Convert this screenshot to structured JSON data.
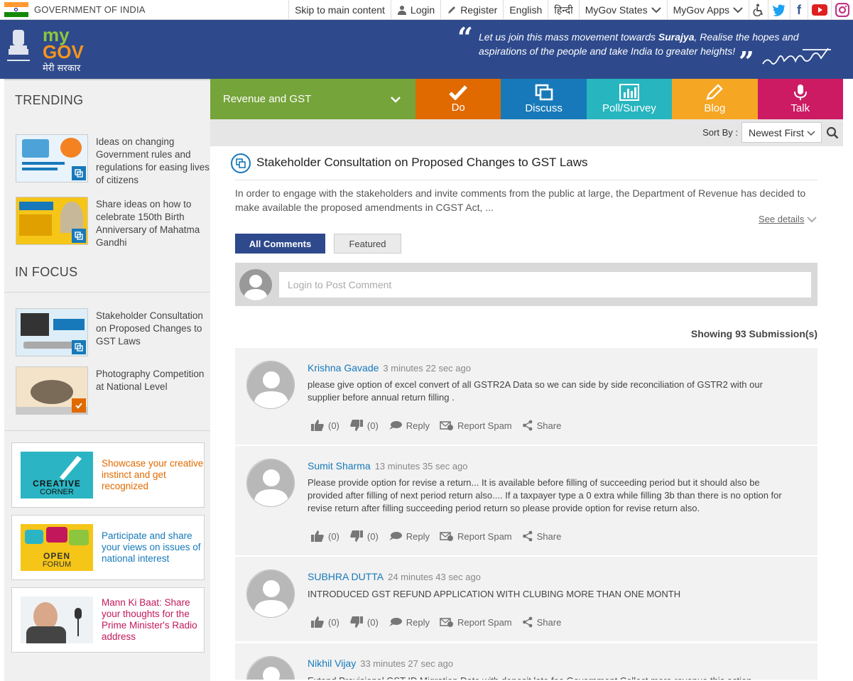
{
  "govbar": {
    "title": "GOVERNMENT OF INDIA",
    "links": [
      "Skip to main content",
      "Login",
      "Register",
      "English",
      "हिन्दी",
      "MyGov States",
      "MyGov Apps"
    ]
  },
  "header": {
    "logo_top": "my",
    "logo_mid": "GOV",
    "logo_sub": "मेरी सरकार",
    "quote_a": "Let us join this mass movement towards ",
    "quote_b": "Surajya",
    "quote_c": ", Realise the hopes and aspirations of the people and take India to greater heights!"
  },
  "sidebar": {
    "trending_title": "TRENDING",
    "trending": [
      {
        "text": "Ideas on changing Government rules and regulations for easing lives of citizens"
      },
      {
        "text": "Share ideas on how to celebrate 150th Birth Anniversary of Mahatma Gandhi"
      }
    ],
    "focus_title": "IN FOCUS",
    "focus": [
      {
        "text": "Stakeholder Consultation on Proposed Changes to GST Laws"
      },
      {
        "text": "Photography Competition at National Level"
      }
    ],
    "promos": [
      {
        "text": "Showcase your creative instinct and get recognized",
        "img_label_a": "CREATIVE",
        "img_label_b": "CORNER",
        "color": "#e06a00"
      },
      {
        "text": "Participate and share your views on issues of national interest",
        "img_label_a": "OPEN",
        "img_label_b": "FORUM",
        "color": "#1779ba"
      },
      {
        "text": "Mann Ki Baat: Share your thoughts for the Prime Minister's Radio address",
        "color": "#c2185b"
      }
    ]
  },
  "tabs": {
    "dropdown": "Revenue and GST",
    "items": [
      {
        "label": "Do",
        "color": "#e06a00"
      },
      {
        "label": "Discuss",
        "color": "#1779ba"
      },
      {
        "label": "Poll/Survey",
        "color": "#27b5bf"
      },
      {
        "label": "Blog",
        "color": "#f5a623"
      },
      {
        "label": "Talk",
        "color": "#cc1a63"
      }
    ]
  },
  "sort": {
    "label": "Sort By :",
    "value": "Newest First"
  },
  "discussion": {
    "title": "Stakeholder Consultation on Proposed Changes to GST Laws",
    "description": "In order to engage with the stakeholders and invite comments from the public at large, the Department of Revenue has decided to make available the proposed amendments in CGST Act, ...",
    "see_details": "See details",
    "tab_all": "All Comments",
    "tab_featured": "Featured",
    "post_placeholder": "Login to Post Comment",
    "showing": "Showing 93 Submission(s)"
  },
  "comments": [
    {
      "name": "Krishna Gavade",
      "time": "3 minutes 22 sec ago",
      "text": "please give option of excel convert of all GSTR2A Data so we can side by side reconciliation of GSTR2 with our supplier before annual return filling .",
      "likes": "(0)",
      "dislikes": "(0)"
    },
    {
      "name": "Sumit Sharma",
      "time": "13 minutes 35 sec ago",
      "text": "Please provide option for revise a return... It is available before filling of succeeding period but it should also be provided after filling of next period return also.... If a taxpayer type a 0 extra while filling 3b than there is no option for revise return after filling succeeding period return so please provide option for revise return also.",
      "likes": "(0)",
      "dislikes": "(0)"
    },
    {
      "name": "SUBHRA DUTTA",
      "time": "24 minutes 43 sec ago",
      "text": "INTRODUCED GST REFUND APPLICATION WITH CLUBING MORE THAN ONE MONTH",
      "likes": "(0)",
      "dislikes": "(0)"
    },
    {
      "name": "Nikhil Vijay",
      "time": "33 minutes 27 sec ago",
      "text": "Extend Provisional GST ID Migration Date with deposit late fee Government Collect more revenue this action",
      "likes": "",
      "dislikes": ""
    }
  ],
  "actions": {
    "reply": "Reply",
    "spam": "Report Spam",
    "share": "Share"
  }
}
